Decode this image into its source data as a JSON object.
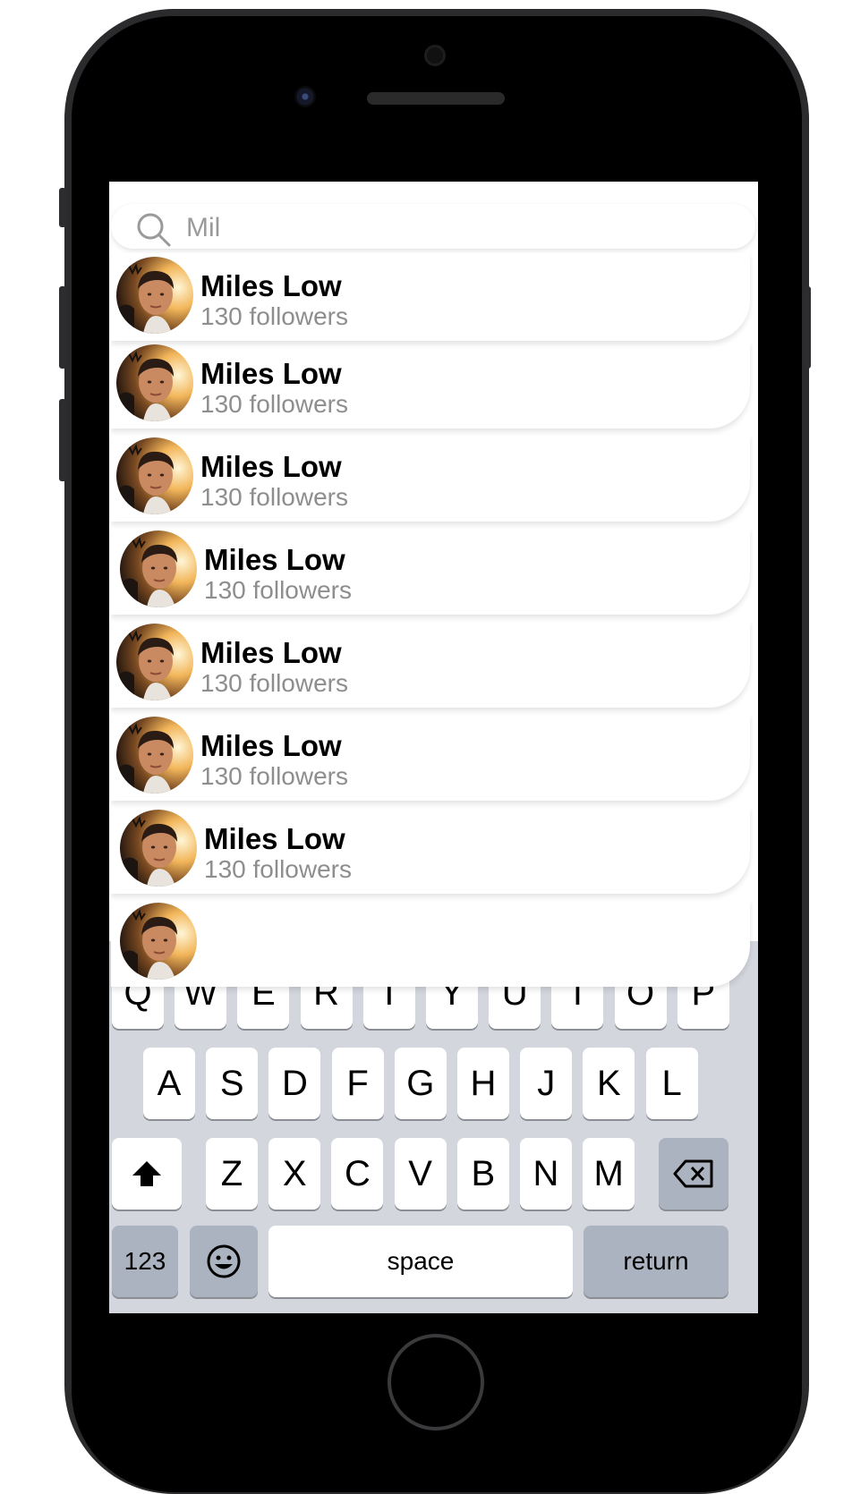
{
  "search": {
    "query": "Mil",
    "icon": "search-icon"
  },
  "results": [
    {
      "name": "Miles Low",
      "followers": "130 followers"
    },
    {
      "name": "Miles Low",
      "followers": "130 followers"
    },
    {
      "name": "Miles Low",
      "followers": "130 followers"
    },
    {
      "name": "Miles Low",
      "followers": "130 followers"
    },
    {
      "name": "Miles Low",
      "followers": "130 followers"
    },
    {
      "name": "Miles Low",
      "followers": "130 followers"
    },
    {
      "name": "Miles Low",
      "followers": "130 followers"
    }
  ],
  "keyboard": {
    "row1": [
      "Q",
      "W",
      "E",
      "R",
      "T",
      "Y",
      "U",
      "I",
      "O",
      "P"
    ],
    "row2": [
      "A",
      "S",
      "D",
      "F",
      "G",
      "H",
      "J",
      "K",
      "L"
    ],
    "row3": [
      "Z",
      "X",
      "C",
      "V",
      "B",
      "N",
      "M"
    ],
    "shift_icon": "shift-arrow-icon",
    "delete_icon": "backspace-icon",
    "numbers_label": "123",
    "emoji_icon": "emoji-smile-icon",
    "space_label": "space",
    "return_label": "return"
  },
  "colors": {
    "keyboard_bg": "#d3d6dd",
    "dark_key": "#abb3c0",
    "secondary_text": "#8e8e8e"
  }
}
